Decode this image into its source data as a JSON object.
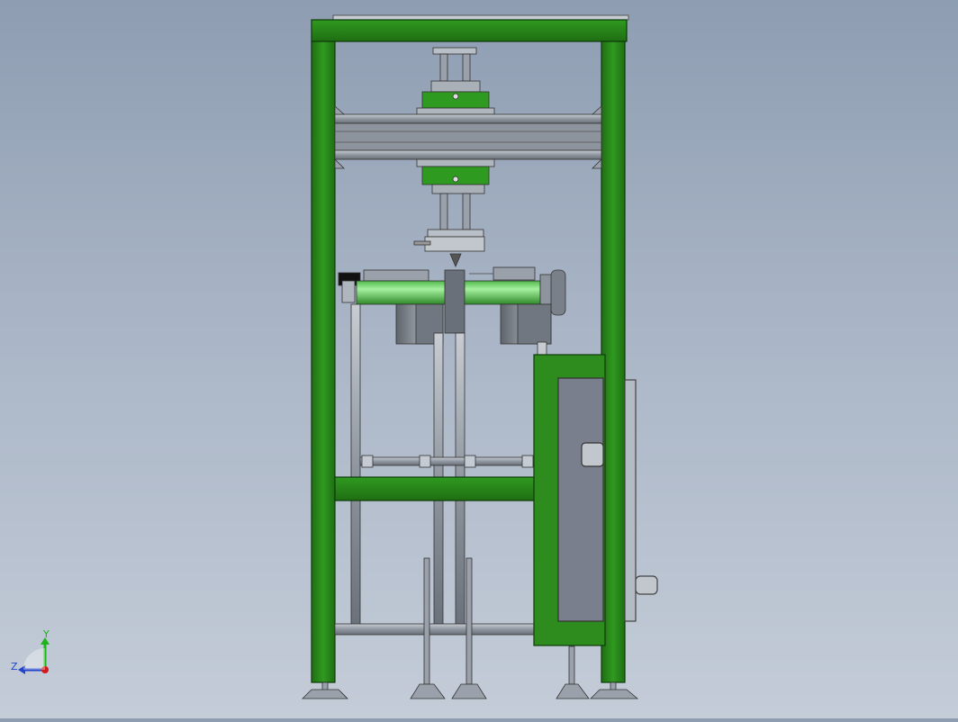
{
  "viewport": {
    "background_top": "#8e9db2",
    "background_bottom": "#c4ccd8"
  },
  "model": {
    "frame_color": "#2e8b1e",
    "frame_outline": "#0f3a0a",
    "steel_color": "#9aa1aa",
    "steel_dark": "#5d636b",
    "roller_color": "#6fd66a",
    "motor_color": "#7c828a",
    "panel_color": "#7a7f8e"
  },
  "triad": {
    "x_label": "",
    "y_label": "Y",
    "z_label": "Z",
    "y_color": "#1db31d",
    "z_color": "#2244cc",
    "x_color": "#d11a1a"
  }
}
